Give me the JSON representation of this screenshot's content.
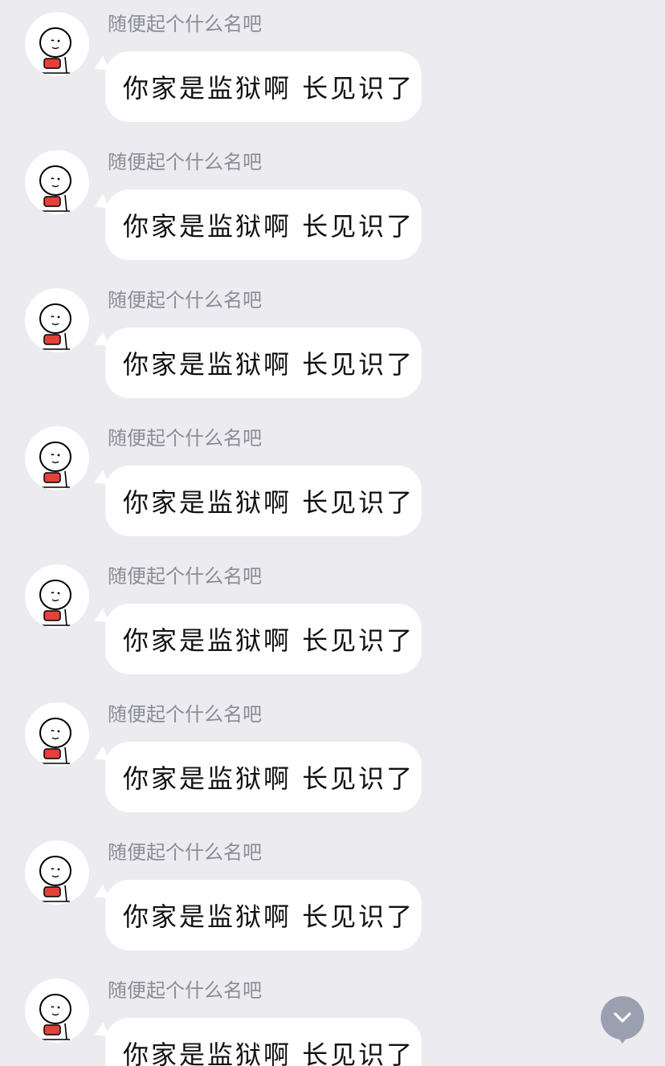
{
  "messages": [
    {
      "sender": "随便起个什么名吧",
      "text": "你家是监狱啊 长见识了"
    },
    {
      "sender": "随便起个什么名吧",
      "text": "你家是监狱啊 长见识了"
    },
    {
      "sender": "随便起个什么名吧",
      "text": "你家是监狱啊 长见识了"
    },
    {
      "sender": "随便起个什么名吧",
      "text": "你家是监狱啊 长见识了"
    },
    {
      "sender": "随便起个什么名吧",
      "text": "你家是监狱啊 长见识了"
    },
    {
      "sender": "随便起个什么名吧",
      "text": "你家是监狱啊 长见识了"
    },
    {
      "sender": "随便起个什么名吧",
      "text": "你家是监狱啊 长见识了"
    },
    {
      "sender": "随便起个什么名吧",
      "text": "你家是监狱啊 长见识了"
    }
  ],
  "scroll_button": {
    "icon": "chevron-down-icon"
  },
  "colors": {
    "background": "#ebebf0",
    "bubble": "#ffffff",
    "sender_name": "#8c8c96",
    "scroll_button": "#9ba0b0"
  }
}
